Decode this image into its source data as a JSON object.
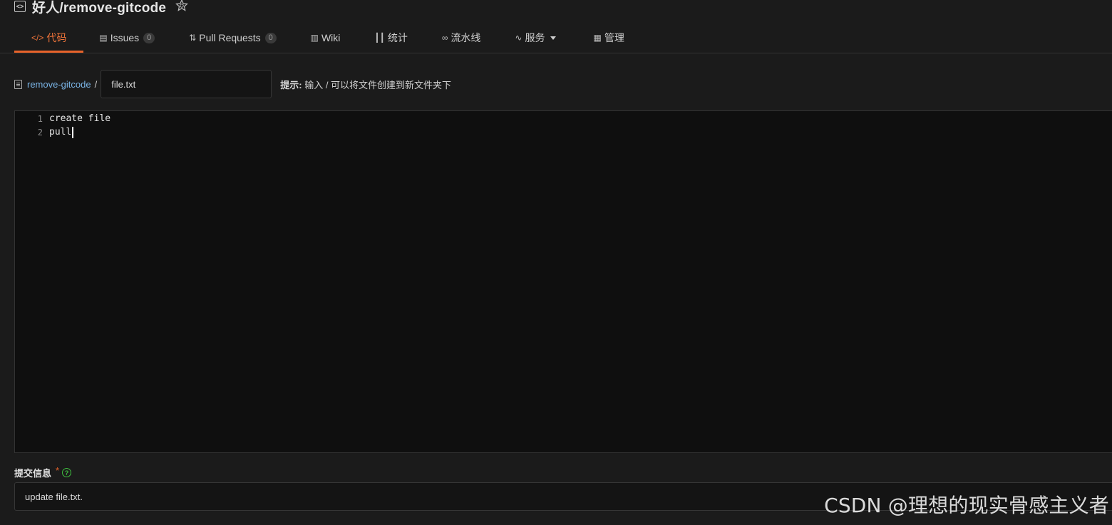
{
  "repo": {
    "title": "好人/remove-gitcode"
  },
  "tabs": [
    {
      "label": "代码",
      "icon": "code-icon",
      "glyph": "</>",
      "active": true
    },
    {
      "label": "Issues",
      "icon": "issues-icon",
      "glyph": "▤",
      "count": "0"
    },
    {
      "label": "Pull Requests",
      "icon": "pull-request-icon",
      "glyph": "⇅",
      "count": "0"
    },
    {
      "label": "Wiki",
      "icon": "wiki-icon",
      "glyph": "▥"
    },
    {
      "label": "统计",
      "icon": "stats-icon",
      "glyph": "┃┃"
    },
    {
      "label": "流水线",
      "icon": "pipeline-icon",
      "glyph": "∞"
    },
    {
      "label": "服务",
      "icon": "activity-icon",
      "glyph": "∿"
    },
    {
      "label": "管理",
      "icon": "manage-icon",
      "glyph": "▦"
    }
  ],
  "path": {
    "repo_link": "remove-gitcode",
    "separator": "/",
    "filename_value": "file.txt",
    "hint_label": "提示:",
    "hint_text": "输入 / 可以将文件创建到新文件夹下"
  },
  "editor": {
    "lines": [
      {
        "number": "1",
        "text": "create file"
      },
      {
        "number": "2",
        "text": "pull"
      }
    ]
  },
  "commit": {
    "label": "提交信息",
    "required_mark": "*",
    "help_glyph": "?",
    "value": "update file.txt."
  },
  "watermark": "CSDN @理想的现实骨感主义者",
  "colors": {
    "accent": "#e8632a",
    "link": "#7ab4e6",
    "help": "#3fbf3f",
    "background": "#1b1b1b",
    "editor_background": "#0f0f0f"
  }
}
